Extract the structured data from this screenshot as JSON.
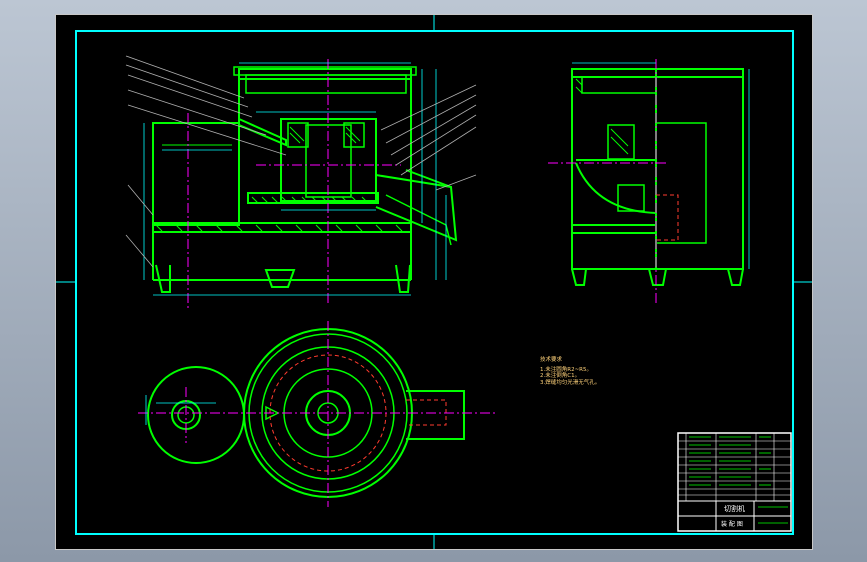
{
  "drawing": {
    "notes": {
      "heading": "技术要求",
      "lines": [
        "1.未注圆角R2~R5。",
        "2.未注倒角C1。",
        "3.焊缝均匀光滑无气孔。"
      ]
    },
    "title_block": {
      "title": "切割机",
      "bottom_label": "装 配 图"
    },
    "colors": {
      "background": "#000000",
      "frame": "#00ffff",
      "object_line": "#00ff00",
      "center_line": "#ff00ff",
      "dimension_line": "#00ffff",
      "hidden_line": "#ff3b2f",
      "note_text": "#ffd27a",
      "title_text": "#ffffff"
    }
  }
}
